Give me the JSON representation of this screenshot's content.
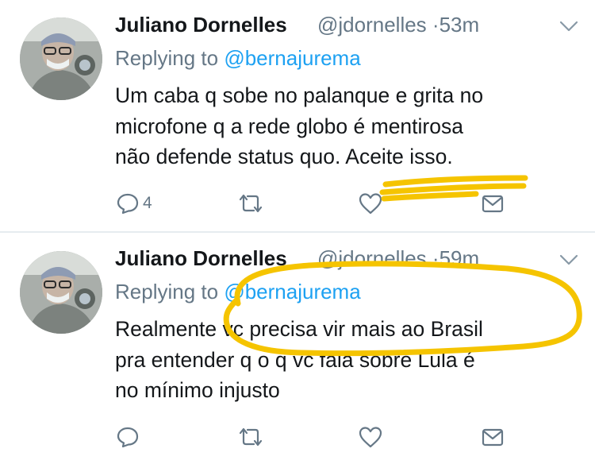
{
  "tweets": [
    {
      "name": "Juliano Dornelles",
      "handle": "@jdornelles",
      "separator": "·",
      "time": "53m",
      "replying_prefix": "Replying to",
      "replying_to": "@bernajurema",
      "lines": [
        "Um caba q sobe no palanque e grita no",
        "microfone q a rede globo é mentirosa",
        "não defende status quo. Aceite isso."
      ],
      "reply_count": "4",
      "retweet_count": "",
      "like_count": ""
    },
    {
      "name": "Juliano Dornelles",
      "handle": "@jdornelles",
      "separator": "·",
      "time": "59m",
      "replying_prefix": "Replying to",
      "replying_to": "@bernajurema",
      "lines": [
        "Realmente vc precisa vir mais ao Brasil",
        "pra entender q o q vc fala sobre Lula é",
        "no mínimo injusto"
      ],
      "reply_count": "",
      "retweet_count": "",
      "like_count": ""
    }
  ],
  "colors": {
    "text": "#14171a",
    "secondary": "#657786",
    "link": "#1da1f2",
    "icon": "#657786",
    "highlight": "#f5c400",
    "divider": "#e6ecf0"
  },
  "icons": [
    "reply-icon",
    "retweet-icon",
    "like-icon",
    "message-icon",
    "chevron-down-icon"
  ]
}
